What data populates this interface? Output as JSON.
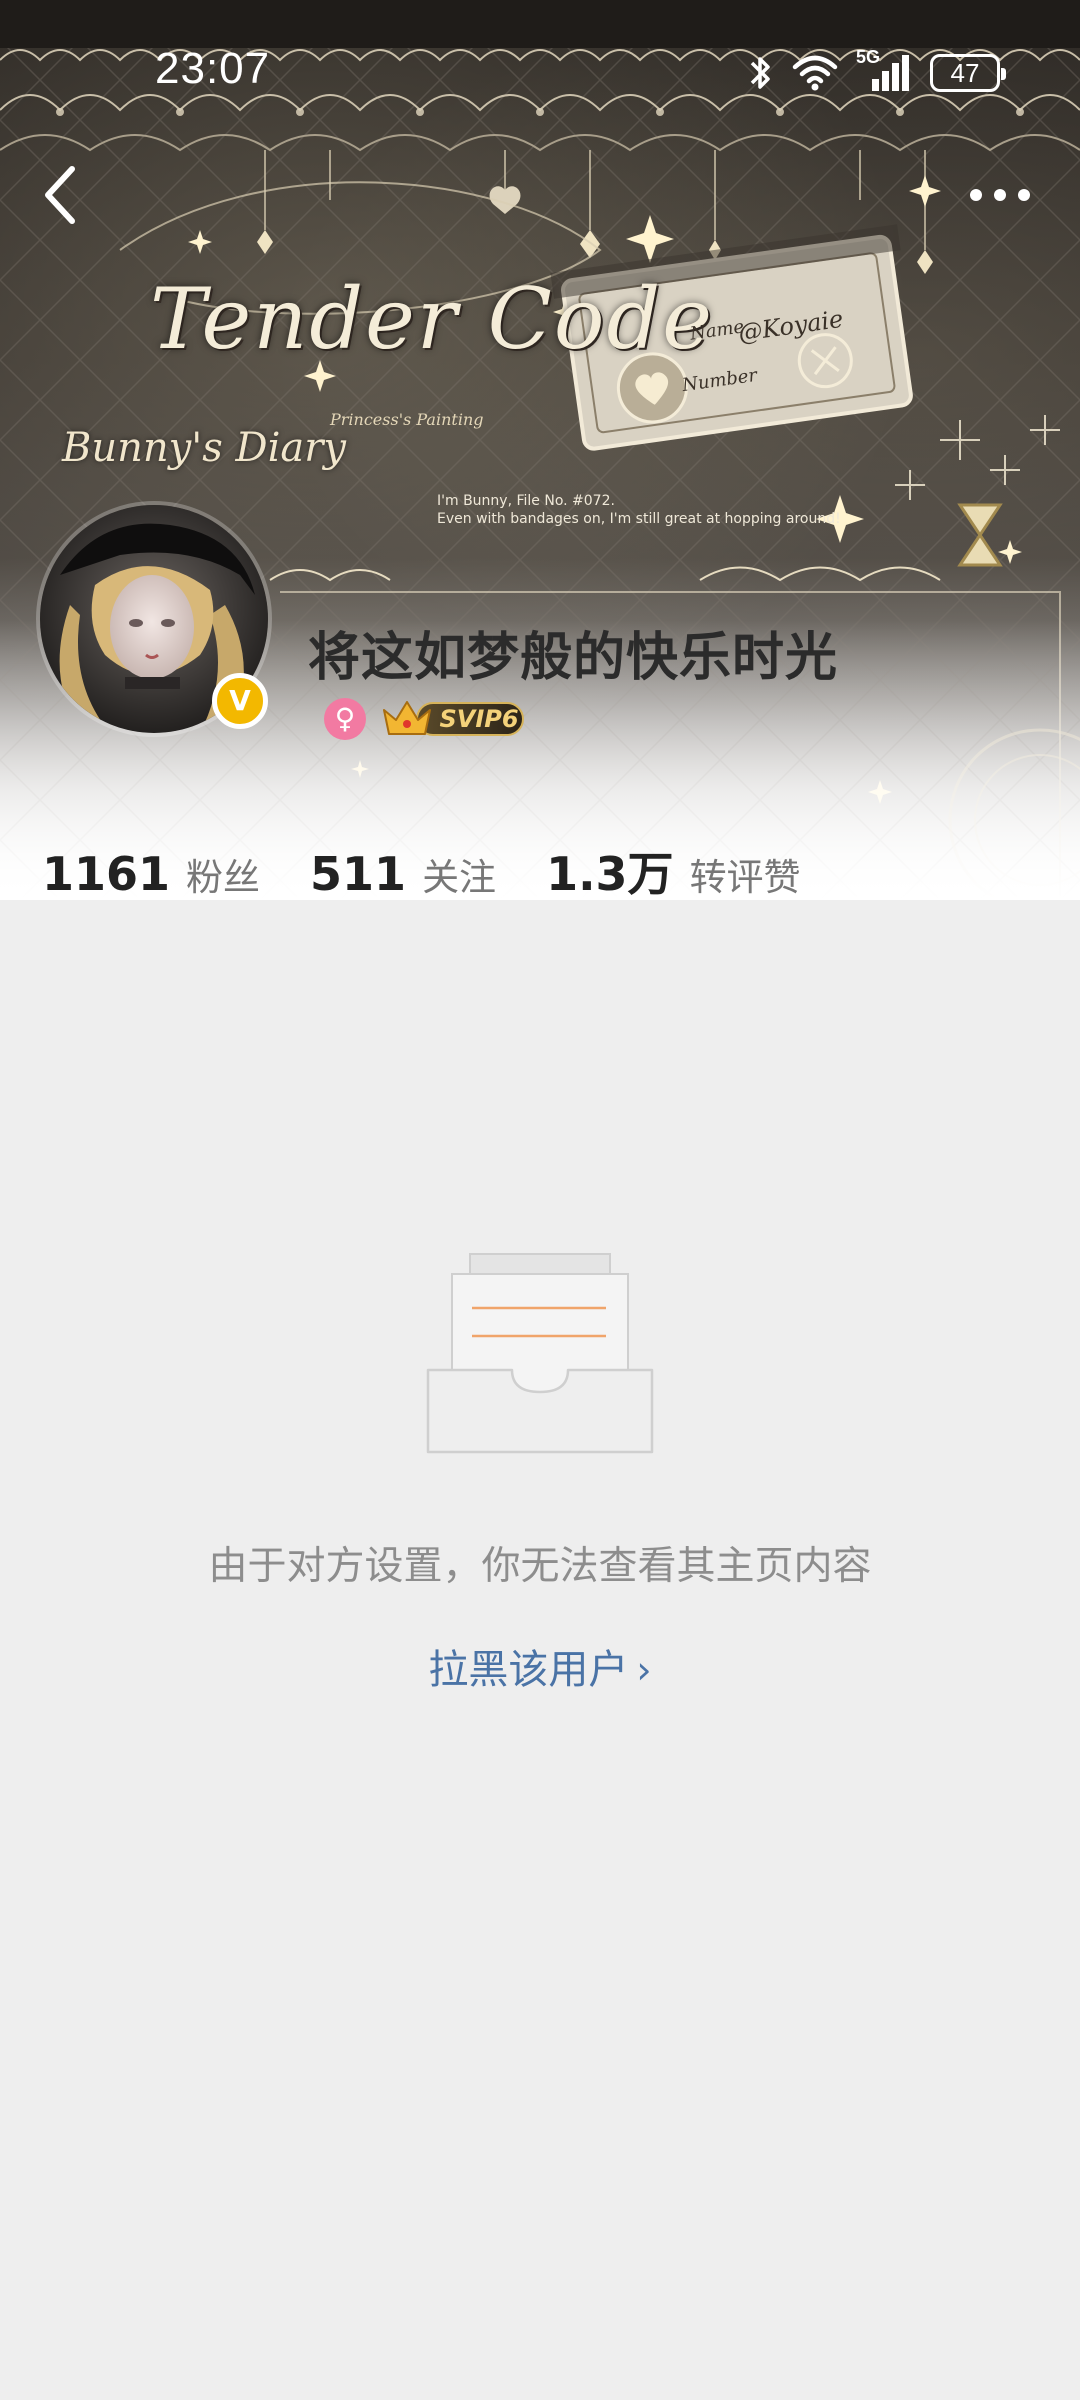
{
  "status_bar": {
    "time": "23:07",
    "network_label": "5G",
    "battery_level": "47",
    "icons": [
      "bluetooth-icon",
      "wifi-icon",
      "cellular-signal-icon",
      "battery-icon"
    ]
  },
  "nav": {
    "back_icon": "chevron-left-icon",
    "more_icon": "more-dots-icon"
  },
  "cover": {
    "title": "Tender Code",
    "subtitle": "Bunny's Diary",
    "tagline": "Princess's Painting",
    "note_line_1": "I'm Bunny, File No. #072.",
    "note_line_2": "Even with bandages on, I'm still great at hopping around!",
    "ticket_name_label": "Name",
    "ticket_name_value": "@Koyaie",
    "ticket_number_label": "Number"
  },
  "profile": {
    "username": "将这如梦般的快乐时光",
    "verified_mark": "V",
    "gender_symbol": "♀",
    "svip_label": "SVIP6"
  },
  "stats": [
    {
      "value": "1161",
      "label": "粉丝"
    },
    {
      "value": "511",
      "label": "关注"
    },
    {
      "value": "1.3万",
      "label": "转评赞"
    }
  ],
  "content": {
    "empty_message": "由于对方设置，你无法查看其主页内容",
    "block_user_label": "拉黑该用户",
    "block_user_chevron": "›"
  },
  "colors": {
    "page_background": "#eeeeee",
    "link_blue": "#4a73a6",
    "verified_gold": "#f3b800",
    "gender_pink": "#f27aa2",
    "illustration_accent": "#f0a46a"
  }
}
